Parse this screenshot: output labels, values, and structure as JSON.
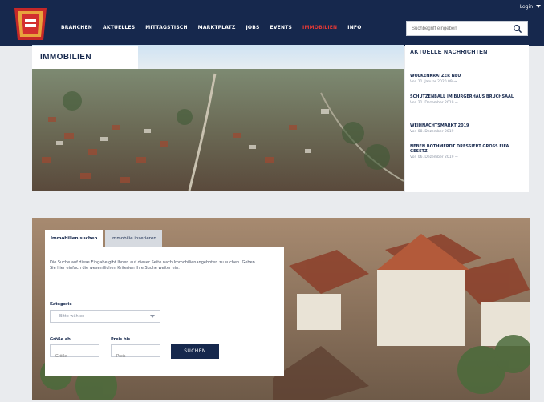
{
  "header": {
    "nav": [
      "BRANCHEN",
      "AKTUELLES",
      "MITTAGSTISCH",
      "MARKTPLATZ",
      "JOBS",
      "EVENTS",
      "IMMOBILIEN",
      "INFO"
    ],
    "active_nav": "IMMOBILIEN",
    "login_label": "Login",
    "search_placeholder": "Suchbegriff eingeben"
  },
  "page": {
    "title": "IMMOBILIEN"
  },
  "news": {
    "heading": "AKTUELLE NACHRICHTEN",
    "items": [
      {
        "title": "WOLKENKRATZER NEU",
        "date": "Von 11. Januar 2020 09 →"
      },
      {
        "title": "SCHÜTZENBALL IM BÜRGERHAUS BRUCHSAAL",
        "date": "Von 21. Dezember 2019 →"
      },
      {
        "title": "WEIHNACHTSMARKT 2019",
        "date": "Von 08. Dezember 2019 →"
      },
      {
        "title": "NEBEN BOTHMERDT DRESSIERT GROSS EIFA GESETZ",
        "date": "Von 06. Dezember 2019 →"
      }
    ]
  },
  "search_card": {
    "tab_active": "Immobilien suchen",
    "tab_other": "Immobilie inserieren",
    "intro": "Die Suche auf diese Eingabe gibt Ihnen auf dieser Seite nach Immobilienangeboten zu suchen. Geben Sie hier einfach die wesentlichen Kriterien Ihre Suche weiter ein.",
    "category_label": "Kategorie",
    "category_value": "—Bitte wählen—",
    "size_label": "Größe ab",
    "size_placeholder": "Größe",
    "price_label": "Preis bis",
    "price_placeholder": "Preis",
    "submit_label": "SUCHEN"
  }
}
